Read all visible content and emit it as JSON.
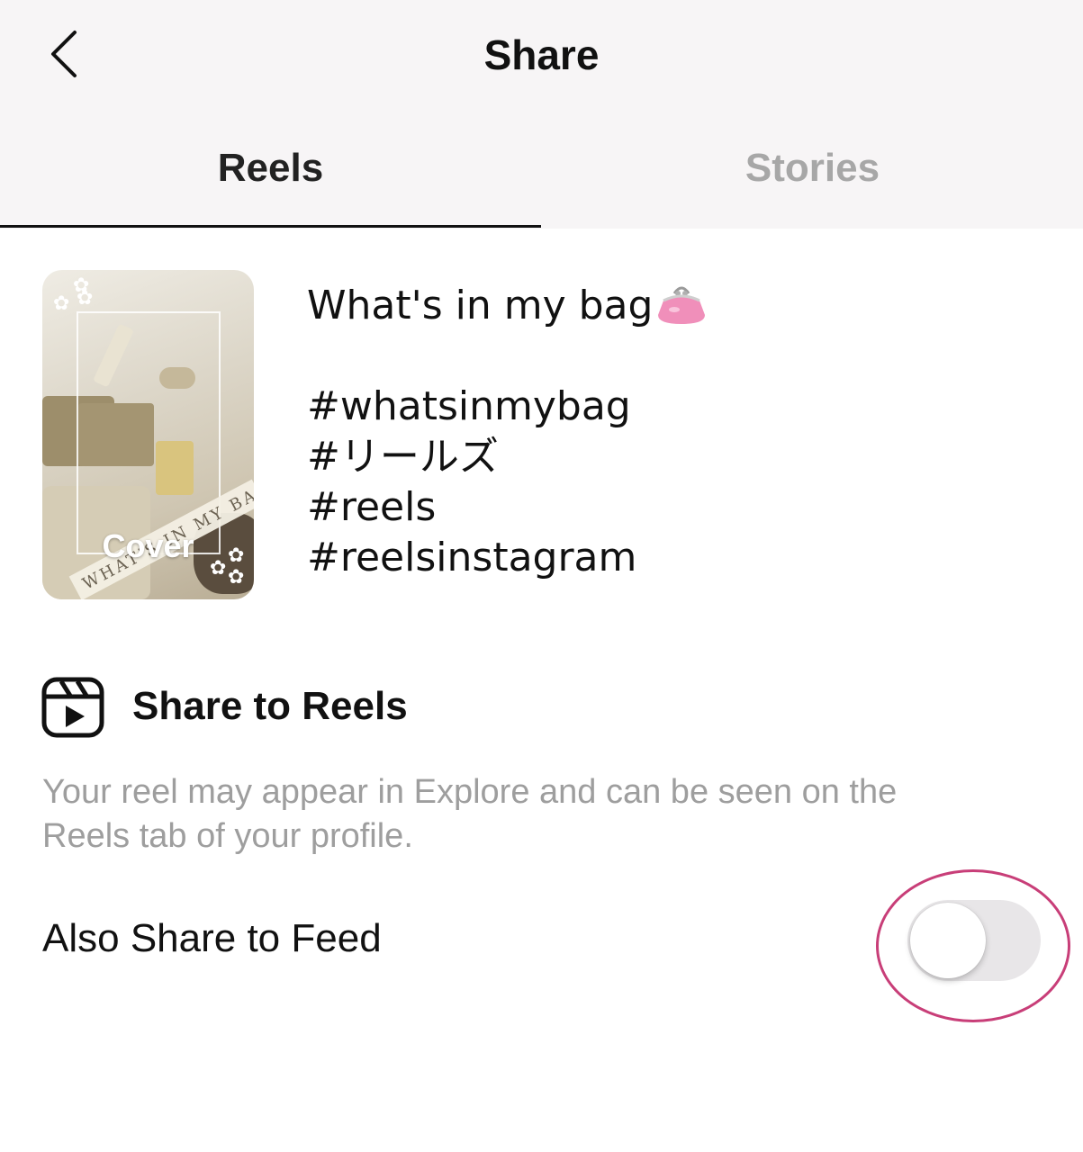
{
  "header": {
    "title": "Share",
    "back_icon": "chevron-left-icon"
  },
  "tabs": [
    {
      "label": "Reels",
      "active": true
    },
    {
      "label": "Stories",
      "active": false
    }
  ],
  "post": {
    "cover_label": "Cover",
    "thumbnail_text": "WHAT'S IN MY BAG",
    "caption_lines": [
      "What's in my bag",
      "",
      "#whatsinmybag",
      "#リールズ",
      "#reels",
      "#reelsinstagram"
    ],
    "caption_emoji": "purse-emoji"
  },
  "share_to_reels": {
    "icon": "reels-icon",
    "title": "Share to Reels",
    "description_line1": "Your reel may appear in Explore and can be seen on the",
    "description_line2": "Reels tab of your profile."
  },
  "feed_option": {
    "label": "Also Share to Feed",
    "toggle_on": false
  },
  "colors": {
    "header_bg": "#f7f5f6",
    "active_tab": "#222222",
    "inactive_tab": "#a7a7a7",
    "description": "#9e9e9e",
    "toggle_off_track": "#e8e6e8",
    "highlight_ring": "#c83e78"
  }
}
